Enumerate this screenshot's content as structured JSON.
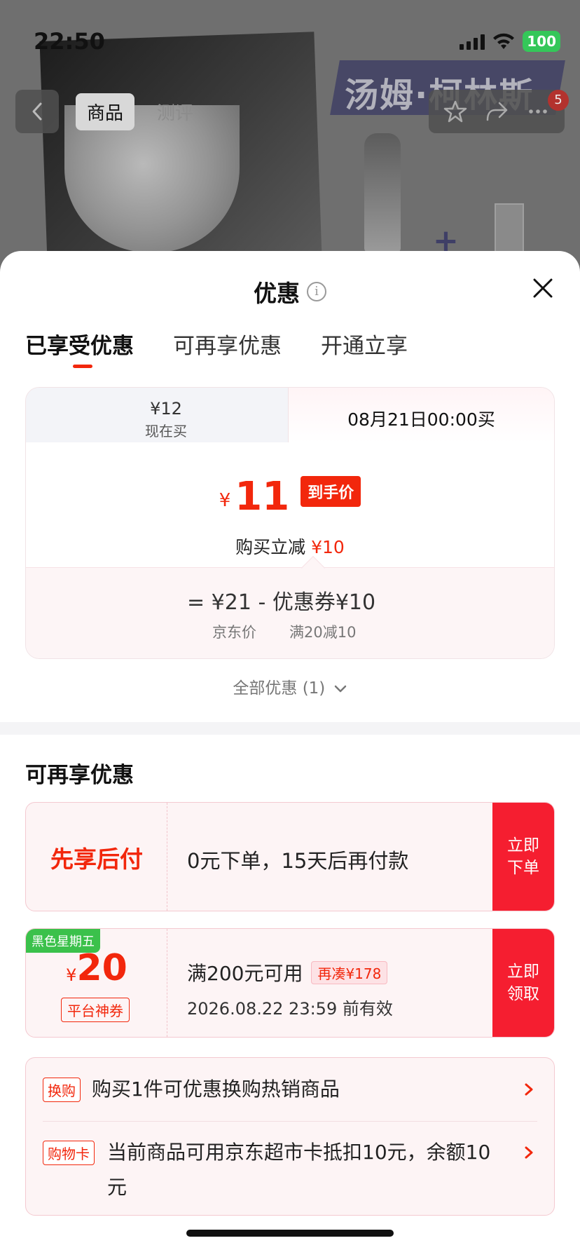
{
  "status_bar": {
    "time": "22:50",
    "battery": "100"
  },
  "background_page": {
    "tabs": [
      {
        "label": "商品"
      },
      {
        "label": "测评"
      }
    ],
    "banner_text": "汤姆·柯林斯",
    "badge_count": "5"
  },
  "sheet": {
    "title": "优惠",
    "tabs": [
      {
        "label": "已享受优惠"
      },
      {
        "label": "可再享优惠"
      },
      {
        "label": "开通立享"
      }
    ],
    "price_card": {
      "left_tab_price": "¥12",
      "left_tab_label": "现在买",
      "right_tab_label": "08月21日00:00买",
      "currency": "¥",
      "final_price": "11",
      "final_tag": "到手价",
      "instant_off_label": "购买立减",
      "instant_off_value": "¥10",
      "formula": "=  ¥21  -  优惠券¥10",
      "jd_price_label": "京东价",
      "coupon_label": "满20减10"
    },
    "all_offers": "全部优惠 (1)",
    "section_title": "可再享优惠",
    "offers": [
      {
        "left_title": "先享后付",
        "text": "0元下单，15天后再付款",
        "cta": "立即下单"
      },
      {
        "badge": "黑色星期五",
        "currency": "¥",
        "amount": "20",
        "type_label": "平台神券",
        "condition": "满200元可用",
        "extra_tag": "再凑¥178",
        "validity": "2026.08.22 23:59 前有效",
        "cta": "立即领取"
      }
    ],
    "promo_rows": [
      {
        "tag": "换购",
        "text": "购买1件可优惠换购热销商品"
      },
      {
        "tag": "购物卡",
        "text": "当前商品可用京东超市卡抵扣10元，余额10元"
      }
    ]
  }
}
